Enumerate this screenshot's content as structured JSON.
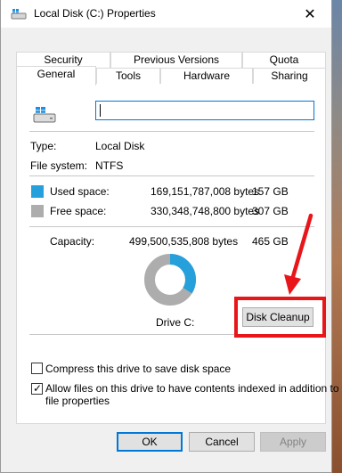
{
  "window": {
    "title": "Local Disk (C:) Properties",
    "close_glyph": "✕"
  },
  "tabs_top": [
    "Security",
    "Previous Versions",
    "Quota"
  ],
  "tabs_bottom": [
    "General",
    "Tools",
    "Hardware",
    "Sharing"
  ],
  "general": {
    "name_value": "",
    "type_label": "Type:",
    "type_value": "Local Disk",
    "fs_label": "File system:",
    "fs_value": "NTFS",
    "used_label": "Used space:",
    "used_bytes": "169,151,787,008 bytes",
    "used_size": "157 GB",
    "free_label": "Free space:",
    "free_bytes": "330,348,748,800 bytes",
    "free_size": "307 GB",
    "capacity_label": "Capacity:",
    "capacity_bytes": "499,500,535,808 bytes",
    "capacity_size": "465 GB",
    "drive_label": "Drive C:",
    "cleanup_button": "Disk Cleanup",
    "compress_label": "Compress this drive to save disk space",
    "compress_checked": false,
    "index_label_line1": "Allow files on this drive to have contents indexed in addition to",
    "index_label_line2": "file properties",
    "index_checked": true
  },
  "usage": {
    "used_fraction": 0.3386
  },
  "colors": {
    "used": "#26a0da",
    "free": "#adadad",
    "annotation": "#e8161a",
    "accent": "#0078d7"
  },
  "footer": {
    "ok": "OK",
    "cancel": "Cancel",
    "apply": "Apply"
  }
}
